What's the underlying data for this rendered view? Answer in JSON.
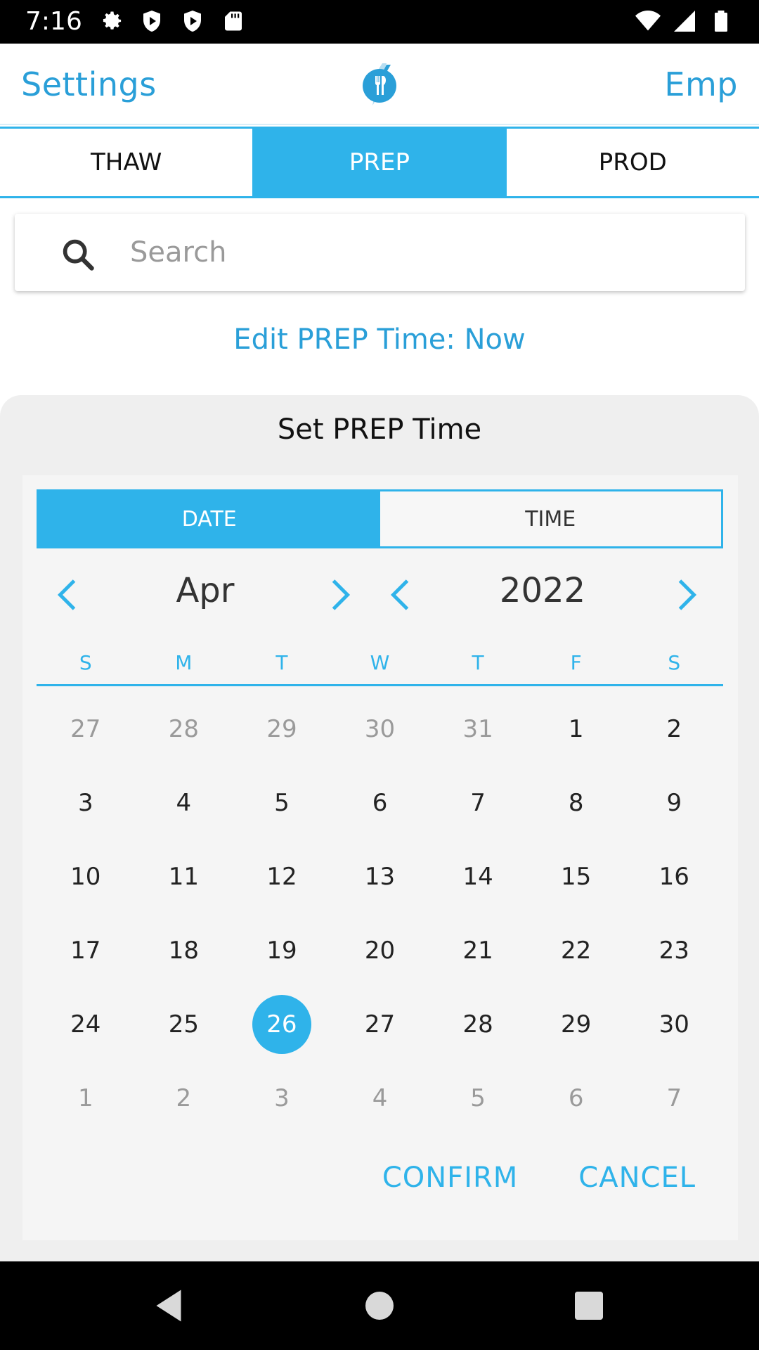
{
  "status_bar": {
    "time": "7:16"
  },
  "header": {
    "left_link": "Settings",
    "right_link": "Emp",
    "logo": "flame-fork-logo"
  },
  "tabs": [
    {
      "label": "THAW",
      "active": false
    },
    {
      "label": "PREP",
      "active": true
    },
    {
      "label": "PROD",
      "active": false
    }
  ],
  "search": {
    "placeholder": "Search",
    "value": ""
  },
  "edit_time_link": "Edit PREP Time: Now",
  "sheet": {
    "title": "Set PREP Time",
    "segments": {
      "date": "DATE",
      "time": "TIME",
      "active": "date"
    },
    "month": "Apr",
    "year": "2022",
    "weekdays": [
      "S",
      "M",
      "T",
      "W",
      "T",
      "F",
      "S"
    ],
    "weeks": [
      [
        {
          "d": "27",
          "m": true
        },
        {
          "d": "28",
          "m": true
        },
        {
          "d": "29",
          "m": true
        },
        {
          "d": "30",
          "m": true
        },
        {
          "d": "31",
          "m": true
        },
        {
          "d": "1"
        },
        {
          "d": "2"
        }
      ],
      [
        {
          "d": "3"
        },
        {
          "d": "4"
        },
        {
          "d": "5"
        },
        {
          "d": "6"
        },
        {
          "d": "7"
        },
        {
          "d": "8"
        },
        {
          "d": "9"
        }
      ],
      [
        {
          "d": "10"
        },
        {
          "d": "11"
        },
        {
          "d": "12"
        },
        {
          "d": "13"
        },
        {
          "d": "14"
        },
        {
          "d": "15"
        },
        {
          "d": "16"
        }
      ],
      [
        {
          "d": "17"
        },
        {
          "d": "18"
        },
        {
          "d": "19"
        },
        {
          "d": "20"
        },
        {
          "d": "21"
        },
        {
          "d": "22"
        },
        {
          "d": "23"
        }
      ],
      [
        {
          "d": "24"
        },
        {
          "d": "25"
        },
        {
          "d": "26",
          "sel": true
        },
        {
          "d": "27"
        },
        {
          "d": "28"
        },
        {
          "d": "29"
        },
        {
          "d": "30"
        }
      ],
      [
        {
          "d": "1",
          "m": true
        },
        {
          "d": "2",
          "m": true
        },
        {
          "d": "3",
          "m": true
        },
        {
          "d": "4",
          "m": true
        },
        {
          "d": "5",
          "m": true
        },
        {
          "d": "6",
          "m": true
        },
        {
          "d": "7",
          "m": true
        }
      ]
    ],
    "confirm": "CONFIRM",
    "cancel": "CANCEL"
  },
  "colors": {
    "accent": "#2fb3ea",
    "link": "#2a9fd8",
    "sheet_bg": "#efefef"
  }
}
